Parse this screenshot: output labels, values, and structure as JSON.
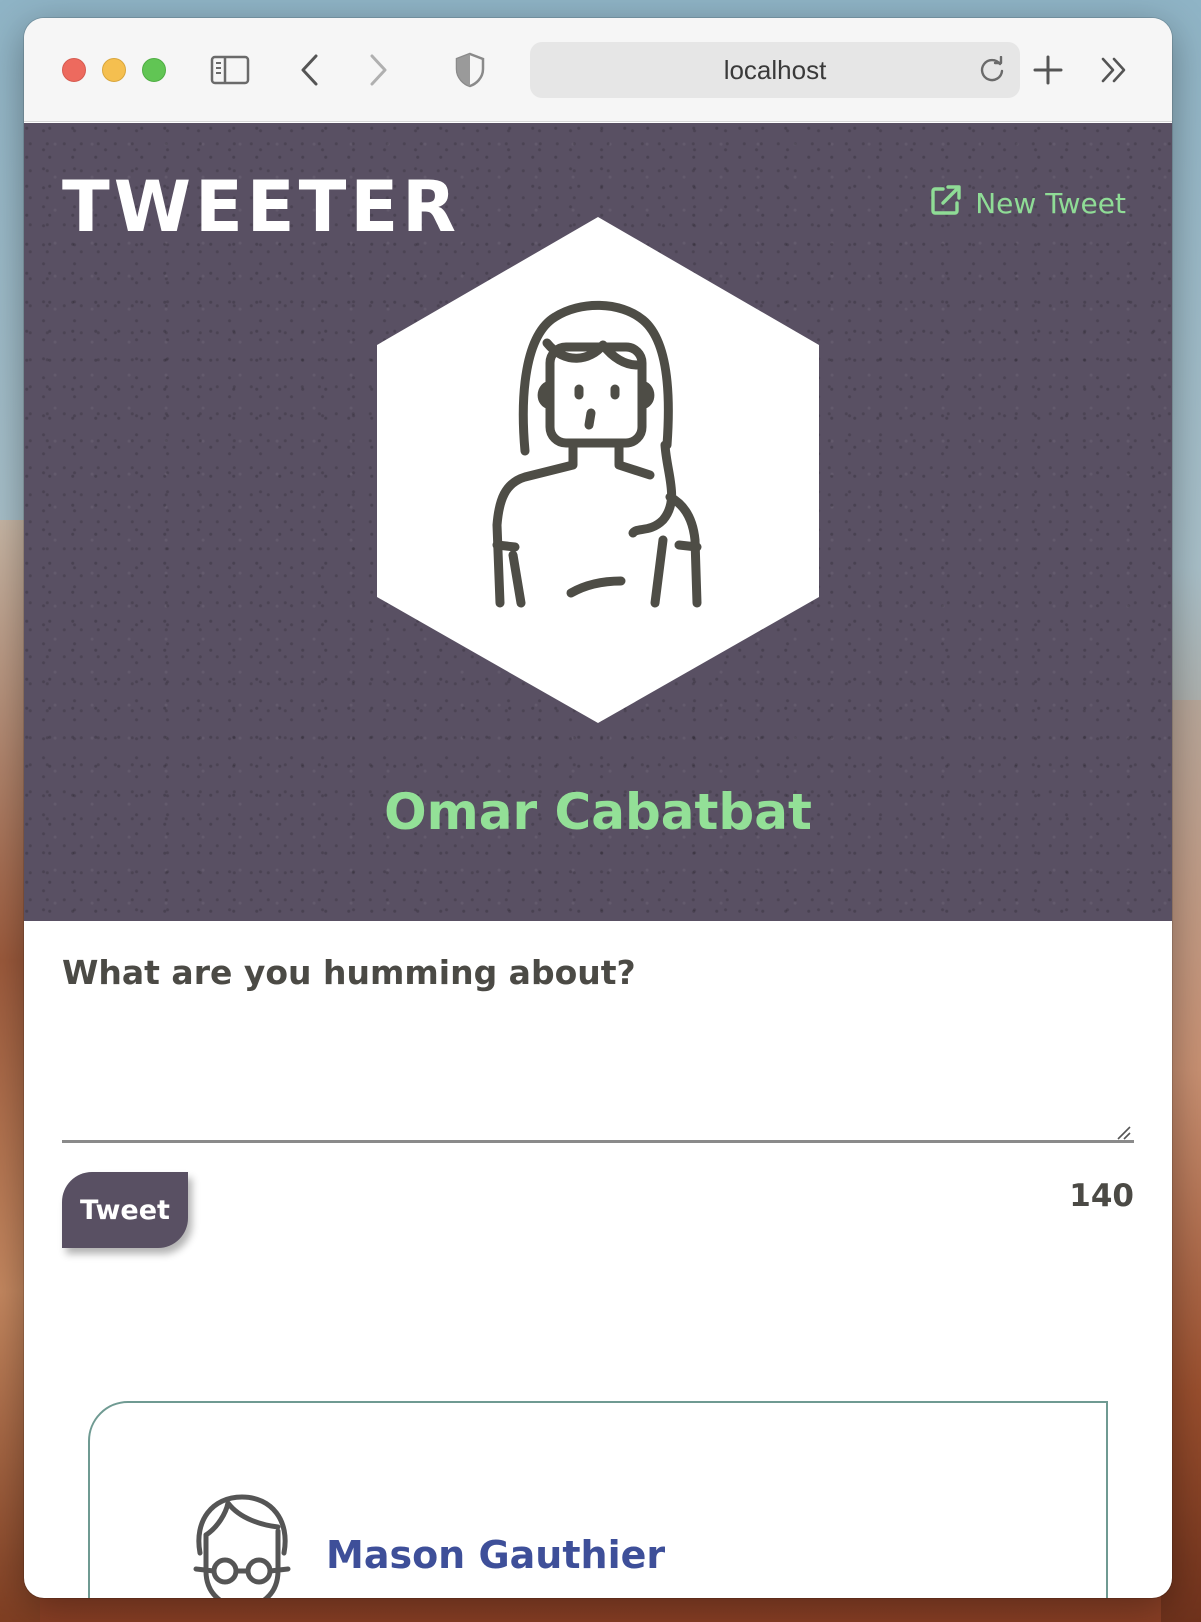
{
  "browser": {
    "url": "localhost",
    "icons": {
      "sidebar": "sidebar-icon",
      "back": "chevron-left-icon",
      "forward": "chevron-right-icon",
      "privacy": "shield-icon",
      "reload": "reload-icon",
      "new_tab": "plus-icon",
      "more": "double-chevron-right-icon"
    }
  },
  "header": {
    "brand": "TWEETER",
    "new_tweet_label": "New Tweet",
    "new_tweet_icon": "external-link-icon"
  },
  "profile": {
    "name": "Omar Cabatbat",
    "avatar_icon": "woman-avatar-icon"
  },
  "compose": {
    "prompt": "What are you humming about?",
    "text_value": "",
    "submit_label": "Tweet",
    "counter": "140"
  },
  "tweets": [
    {
      "author": "Mason Gauthier",
      "avatar_icon": "man-avatar-icon"
    }
  ],
  "colors": {
    "hero_bg": "#595063",
    "accent_green": "#93e097",
    "author_blue": "#3e4f99",
    "card_border": "#6f9a92"
  }
}
